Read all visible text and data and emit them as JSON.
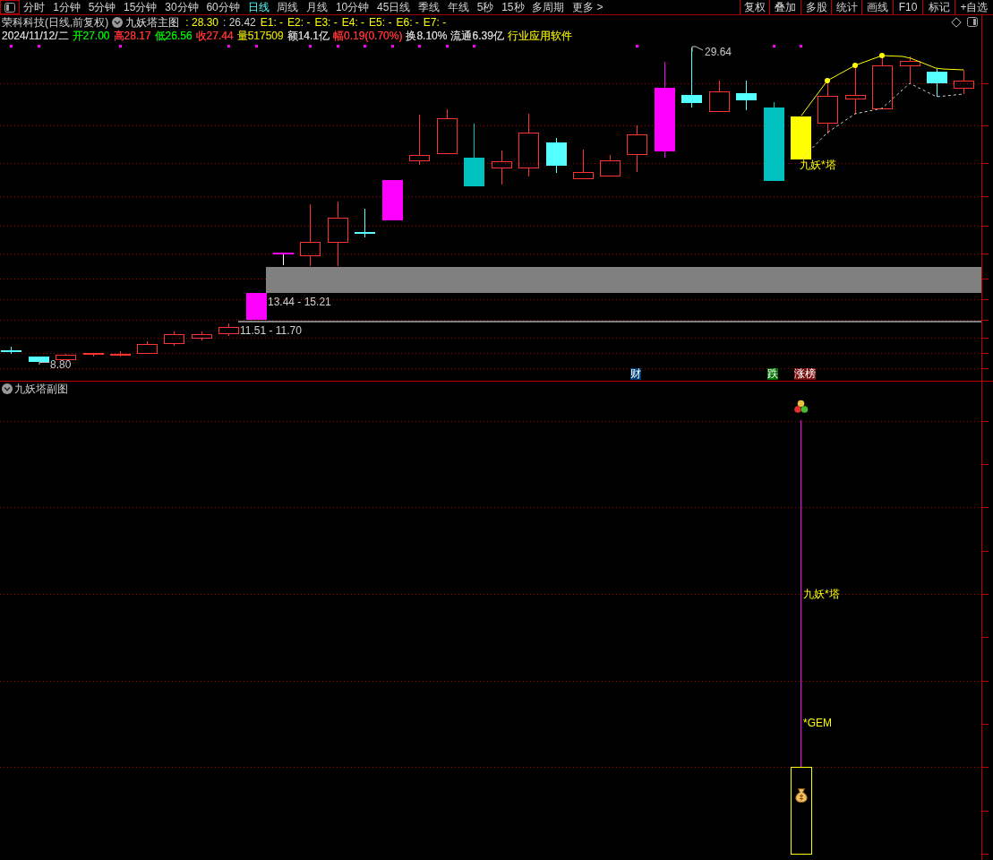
{
  "toolbar": {
    "periods": [
      {
        "label": "分时",
        "selected": false
      },
      {
        "label": "1分钟",
        "selected": false
      },
      {
        "label": "5分钟",
        "selected": false
      },
      {
        "label": "15分钟",
        "selected": false
      },
      {
        "label": "30分钟",
        "selected": false
      },
      {
        "label": "60分钟",
        "selected": false
      },
      {
        "label": "日线",
        "selected": true
      },
      {
        "label": "周线",
        "selected": false
      },
      {
        "label": "月线",
        "selected": false
      },
      {
        "label": "10分钟",
        "selected": false
      },
      {
        "label": "45日线",
        "selected": false
      },
      {
        "label": "季线",
        "selected": false
      },
      {
        "label": "年线",
        "selected": false
      },
      {
        "label": "5秒",
        "selected": false
      },
      {
        "label": "15秒",
        "selected": false
      },
      {
        "label": "多周期",
        "selected": false
      },
      {
        "label": "更多 >",
        "selected": false
      }
    ],
    "buttons": [
      "复权",
      "叠加",
      "多股",
      "统计",
      "画线",
      "F10",
      "标记",
      "+自选"
    ]
  },
  "header": {
    "title": "荣科科技(日线,前复权)",
    "indicator": "九妖塔主图",
    "values": [
      {
        "text": ": 28.30",
        "color": "#ffff00"
      },
      {
        "text": ": 26.42",
        "color": "#d0d0d0"
      },
      {
        "text": "E1: -",
        "color": "#ffff00"
      },
      {
        "text": "E2: -",
        "color": "#ffff00"
      },
      {
        "text": "E3: -",
        "color": "#ffff00"
      },
      {
        "text": "E4: -",
        "color": "#ffff00"
      },
      {
        "text": "E5: -",
        "color": "#ffff00"
      },
      {
        "text": "E6: -",
        "color": "#ffff00"
      },
      {
        "text": "E7: -",
        "color": "#ffff00"
      }
    ]
  },
  "quote": [
    {
      "text": "2024/11/12/二",
      "color": "#d0d0d0"
    },
    {
      "text": "开27.00",
      "color": "#00e600"
    },
    {
      "text": "高28.17",
      "color": "#ff3232"
    },
    {
      "text": "低26.56",
      "color": "#00e600"
    },
    {
      "text": "收27.44",
      "color": "#ff3232"
    },
    {
      "text": "量517509",
      "color": "#c8c800"
    },
    {
      "text": "额14.1亿",
      "color": "#d0d0d0"
    },
    {
      "text": "幅0.19(0.70%)",
      "color": "#ff3232"
    },
    {
      "text": "换8.10%",
      "color": "#d0d0d0"
    },
    {
      "text": "流通6.39亿",
      "color": "#d0d0d0"
    },
    {
      "text": "行业应用软件",
      "color": "#d8d800"
    }
  ],
  "main_chart": {
    "labels": [
      {
        "kind": "high",
        "text": "29.64"
      },
      {
        "kind": "low",
        "text": "8.80"
      },
      {
        "kind": "zone",
        "text": "13.44 - 15.21"
      },
      {
        "kind": "level",
        "text": "11.51 - 11.70"
      },
      {
        "kind": "signal",
        "text": "九妖*塔"
      }
    ],
    "tags": [
      {
        "text": "财",
        "color": "#003c78"
      },
      {
        "text": "跌",
        "color": "#007000"
      },
      {
        "text": "涨榜",
        "color": "#7a1010"
      }
    ]
  },
  "sub_chart": {
    "title": "九妖塔副图",
    "labels": [
      {
        "kind": "signal",
        "text": "九妖*塔"
      },
      {
        "kind": "gem",
        "text": "*GEM"
      }
    ]
  }
}
